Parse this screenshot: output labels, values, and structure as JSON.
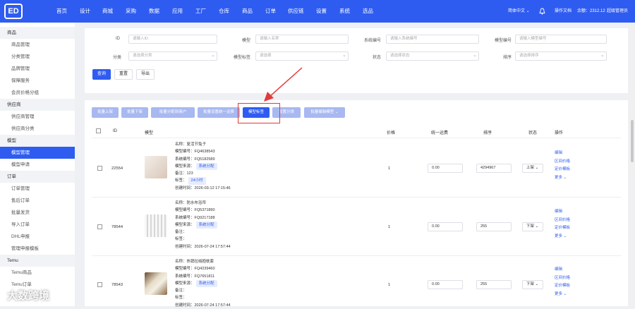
{
  "brand": {
    "logo_text": "ED"
  },
  "nav": [
    "首页",
    "设计",
    "商城",
    "采购",
    "数据",
    "应用",
    "工厂",
    "仓库",
    "商品",
    "订单",
    "供应链",
    "设置",
    "系统",
    "选品"
  ],
  "topright": {
    "lang": "简体中文 ⌄",
    "help": "操作文档",
    "balance": "余额：2312.12",
    "user": "超级管理员"
  },
  "sidebar": [
    {
      "group": "商品",
      "items": [
        "商品管理",
        "分类管理",
        "品牌管理",
        "保障服务",
        "会员价格分组"
      ]
    },
    {
      "group": "供应商",
      "items": [
        "供应商管理",
        "供应商分类"
      ]
    },
    {
      "group": "模型",
      "items": [
        "模型管理",
        "模型申请"
      ]
    },
    {
      "group": "订单",
      "items": [
        "订单管理",
        "售后订单",
        "批量发货",
        "导入订单",
        "DHL申报",
        "管理申报模板"
      ]
    },
    {
      "group": "Temu",
      "items": [
        "Temu商品",
        "Temu订单"
      ]
    }
  ],
  "sidebar_active": "模型管理",
  "filters": {
    "row1": [
      {
        "label": "ID",
        "placeholder": "请输入ID"
      },
      {
        "label": "模型",
        "placeholder": "请输入名称"
      },
      {
        "label": "系统编号",
        "placeholder": "请输入系统编号"
      },
      {
        "label": "模型编号",
        "placeholder": "请输入模型编号"
      }
    ],
    "row2": [
      {
        "label": "分类",
        "placeholder": "请选择分类"
      },
      {
        "label": "模型标签",
        "placeholder": "请选择"
      },
      {
        "label": "状态",
        "placeholder": "请选择状态"
      },
      {
        "label": "排序",
        "placeholder": "请选择排序"
      }
    ],
    "buttons": [
      "查询",
      "重置",
      "导出"
    ]
  },
  "actions": [
    "批量上架",
    "批量下架",
    "批量分配到商户",
    "批量设置统一运费",
    "模型标签",
    "设置分类",
    "批量编辑模型 ⌄"
  ],
  "highlighted_action": "模型标签",
  "columns": [
    "ID",
    "模型",
    "价格",
    "统一运费",
    "排序",
    "状态",
    "操作"
  ],
  "rows": [
    {
      "id": "22554",
      "name": "名称：复活节兔子",
      "model_no": "模型编号：FQ4638543",
      "sys_no": "系统编号：FQ5182589",
      "source": "模型来源：",
      "source_tag": "系统分配",
      "remark": "备注：123",
      "tags": "标签：",
      "tag_value": "24小时",
      "created": "创建时间：2026-03-12 17:15:46",
      "price": "1",
      "freight": "0.00",
      "sort": "4294967",
      "status": "上架 ⌄",
      "ops": [
        "编辑",
        "区间价格",
        "定价模板",
        "更多 ⌄"
      ]
    },
    {
      "id": "78544",
      "name": "名称：防水布浴帘",
      "model_no": "模型编号：FQ5371890",
      "sys_no": "系统编号：FQ9217188",
      "source": "模型来源：",
      "source_tag": "系统分配",
      "remark": "备注：",
      "tags": "标签：",
      "tag_value": "",
      "created": "创建时间：2026-07-24 17:57:44",
      "price": "1",
      "freight": "0.00",
      "sort": "255",
      "status": "下架 ⌄",
      "ops": [
        "编辑",
        "区间价格",
        "定价模板",
        "更多 ⌄"
      ]
    },
    {
      "id": "78543",
      "name": "名称：热销拉绒抱枕套",
      "model_no": "模型编号：FQ4239460",
      "sys_no": "系统编号：FQ7651811",
      "source": "模型来源：",
      "source_tag": "系统分配",
      "remark": "备注：",
      "tags": "标签：",
      "tag_value": "",
      "created": "创建时间：2026-07-24 17:57:44",
      "price": "1",
      "freight": "0.00",
      "sort": "255",
      "status": "下架 ⌄",
      "ops": [
        "编辑",
        "区间价格",
        "定价模板",
        "更多 ⌄"
      ]
    }
  ],
  "watermark": "大数跨境",
  "colors": {
    "primary": "#2f5cf0",
    "annotation": "#e23a3a"
  }
}
